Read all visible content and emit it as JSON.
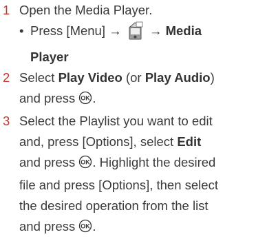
{
  "steps": [
    {
      "number": "1",
      "text": "Open the Media Player.",
      "sub": {
        "bullet": "•",
        "prefix": "Press [Menu] →",
        "arrow": "→",
        "bold": "Media",
        "bold2": "Player"
      }
    },
    {
      "number": "2",
      "l1_a": "Select ",
      "l1_b": "Play Video",
      "l1_c": " (or ",
      "l1_d": "Play Audio",
      "l1_e": ")",
      "l2": "and press"
    },
    {
      "number": "3",
      "l1": "Select the Playlist you want to edit",
      "l2_a": "and, press [Options], select ",
      "l2_b": "Edit",
      "l3": "and press",
      "l3_b": ". Highlight the desired",
      "l4": "file and press [Options], then select",
      "l5": "the desired operation from the list",
      "l6": "and press"
    }
  ],
  "period": ".",
  "icons": {
    "menu": "media-menu-icon",
    "ok": "ok-key-icon"
  },
  "colors": {
    "step_number": "#c0392b",
    "text": "#3a3a3a"
  }
}
